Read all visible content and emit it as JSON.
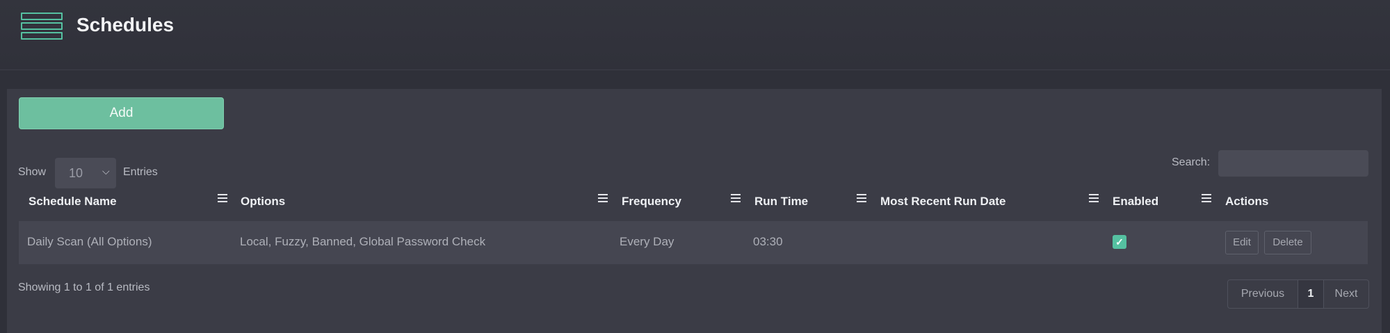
{
  "header": {
    "title": "Schedules",
    "icon": "menu-list-icon",
    "accent_color": "#55c1a1"
  },
  "toolbar": {
    "add_label": "Add"
  },
  "length_control": {
    "show_label": "Show",
    "selected": "10",
    "entries_label": "Entries"
  },
  "search": {
    "label": "Search:",
    "value": ""
  },
  "table": {
    "columns": [
      "Schedule Name",
      "Options",
      "Frequency",
      "Run Time",
      "Most Recent Run Date",
      "Enabled",
      "Actions"
    ],
    "rows": [
      {
        "name": "Daily Scan (All Options)",
        "options": "Local, Fuzzy, Banned, Global Password Check",
        "frequency": "Every Day",
        "run_time": "03:30",
        "recent_run": "",
        "enabled": true,
        "edit_label": "Edit",
        "delete_label": "Delete"
      }
    ]
  },
  "footer": {
    "info": "Showing 1 to 1 of 1 entries",
    "prev_label": "Previous",
    "page": "1",
    "next_label": "Next"
  }
}
